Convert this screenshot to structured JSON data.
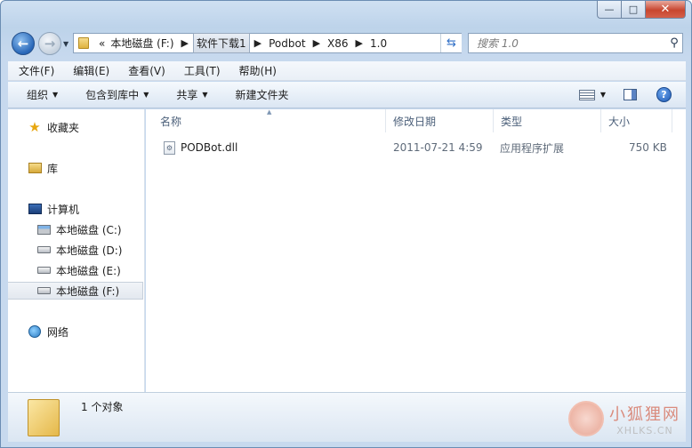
{
  "window": {
    "caption": {
      "minimize_icon": "minimize-icon",
      "maximize_icon": "maximize-icon",
      "close_icon": "close-icon"
    }
  },
  "address_bar": {
    "overflow": "«",
    "crumbs": [
      "本地磁盘 (F:)",
      "软件下载1",
      "Podbot",
      "X86",
      "1.0"
    ]
  },
  "search": {
    "placeholder": "搜索 1.0"
  },
  "menu": [
    "文件(F)",
    "编辑(E)",
    "查看(V)",
    "工具(T)",
    "帮助(H)"
  ],
  "toolbar": {
    "organize": "组织",
    "include_in_library": "包含到库中",
    "share": "共享",
    "new_folder": "新建文件夹"
  },
  "nav": {
    "favorites": "收藏夹",
    "libraries": "库",
    "computer": "计算机",
    "drives": [
      "本地磁盘 (C:)",
      "本地磁盘 (D:)",
      "本地磁盘 (E:)",
      "本地磁盘 (F:)"
    ],
    "network": "网络"
  },
  "columns": {
    "name": "名称",
    "modified": "修改日期",
    "type": "类型",
    "size": "大小"
  },
  "files": [
    {
      "name": "PODBot.dll",
      "modified": "2011-07-21 4:59",
      "type": "应用程序扩展",
      "size": "750 KB"
    }
  ],
  "details": {
    "count_text": "1 个对象"
  },
  "watermark": {
    "cn": "小狐狸网",
    "en": "XHLKS.CN"
  }
}
